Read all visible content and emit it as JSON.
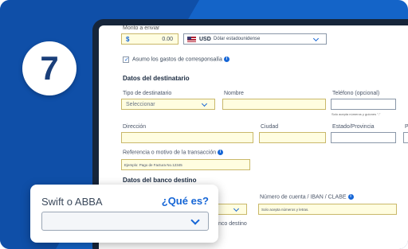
{
  "step": {
    "number": "7"
  },
  "form": {
    "amount_label": "Monto a enviar",
    "currency_symbol": "$",
    "amount_value": "0.00",
    "currency_code": "USD",
    "currency_name": "Dólar estadounidense",
    "fees_checkbox_label": "Asumo los gastos de corresponsalía",
    "section_title": "Datos del destinatario",
    "recipient_type_label": "Tipo de destinatario",
    "recipient_type_value": "Seleccionar",
    "name_label": "Nombre",
    "phone_label": "Teléfono (opcional)",
    "phone_hint": "Solo acepta números y guiones \"-\"",
    "address_label": "Dirección",
    "city_label": "Ciudad",
    "state_label": "Estado/Provincia",
    "country_label_partial": "P",
    "reference_label": "Referencia o motivo de la transacción",
    "reference_placeholder": "Ejemplo: Pago de Factura No.12345",
    "bank_section_partial": "Datos del banco destino",
    "account_label": "Número de cuenta / IBAN / CLABE",
    "account_hint": "Solo acepta números y letras.",
    "bank_label_partial": "nco destino"
  },
  "card": {
    "swift_label": "Swift o ABBA",
    "help_link": "¿Qué es?"
  },
  "colors": {
    "background": "#1464c8",
    "accent": "#1666d6",
    "field_fill": "#fffde0",
    "link": "#1666d6"
  }
}
